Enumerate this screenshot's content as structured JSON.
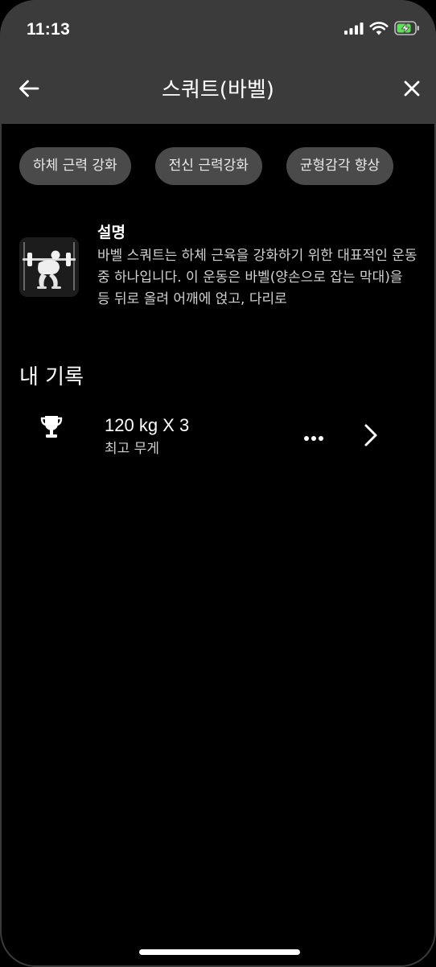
{
  "status_bar": {
    "time": "11:13",
    "icons": [
      "signal-icon",
      "wifi-icon",
      "battery-charging-icon"
    ],
    "battery_color": "#5ee05a"
  },
  "nav": {
    "title": "스쿼트(바벨)",
    "back_icon": "back-arrow-icon",
    "close_icon": "close-icon"
  },
  "tags": [
    "하체 근력 강화",
    "전신 근력강화",
    "균형감각 향상"
  ],
  "description": {
    "title": "설명",
    "body": "바벨 스쿼트는 하체 근육을 강화하기 위한 대표적인 운동 중 하나입니다. 이 운동은 바벨(양손으로 잡는 막대)을 등 뒤로 올려 어깨에 얹고, 다리로",
    "thumbnail_icon": "squat-exercise-icon"
  },
  "records": {
    "title": "내 기록",
    "items": [
      {
        "value": "120 kg X 3",
        "label": "최고 무게",
        "icon": "trophy-icon"
      }
    ]
  },
  "colors": {
    "header_bg": "#3b3b3b",
    "tag_bg": "#4a4a4a",
    "page_bg": "#000000"
  }
}
